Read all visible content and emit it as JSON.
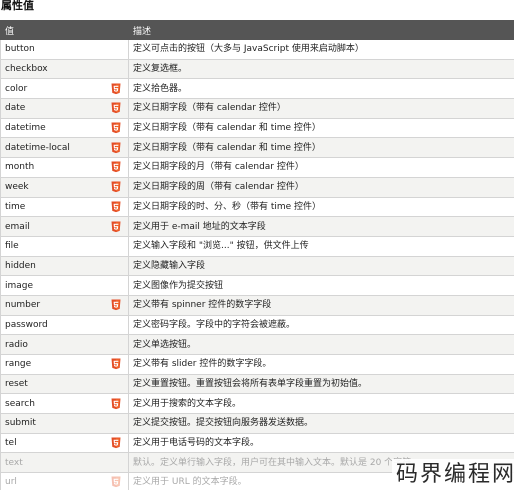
{
  "section_title": "属性值",
  "table": {
    "headers": {
      "value": "值",
      "description": "描述"
    },
    "rows": [
      {
        "value": "button",
        "description": "定义可点击的按钮（大多与 JavaScript 使用来启动脚本）",
        "html5": false
      },
      {
        "value": "checkbox",
        "description": "定义复选框。",
        "html5": false
      },
      {
        "value": "color",
        "description": "定义拾色器。",
        "html5": true
      },
      {
        "value": "date",
        "description": "定义日期字段（带有 calendar 控件）",
        "html5": true
      },
      {
        "value": "datetime",
        "description": "定义日期字段（带有 calendar 和 time 控件）",
        "html5": true
      },
      {
        "value": "datetime-local",
        "description": "定义日期字段（带有 calendar 和 time 控件）",
        "html5": true
      },
      {
        "value": "month",
        "description": "定义日期字段的月（带有 calendar 控件）",
        "html5": true
      },
      {
        "value": "week",
        "description": "定义日期字段的周（带有 calendar 控件）",
        "html5": true
      },
      {
        "value": "time",
        "description": "定义日期字段的时、分、秒（带有 time 控件）",
        "html5": true
      },
      {
        "value": "email",
        "description": "定义用于 e-mail 地址的文本字段",
        "html5": true
      },
      {
        "value": "file",
        "description": "定义输入字段和 \"浏览...\" 按钮，供文件上传",
        "html5": false
      },
      {
        "value": "hidden",
        "description": "定义隐藏输入字段",
        "html5": false
      },
      {
        "value": "image",
        "description": "定义图像作为提交按钮",
        "html5": false
      },
      {
        "value": "number",
        "description": "定义带有 spinner 控件的数字字段",
        "html5": true
      },
      {
        "value": "password",
        "description": "定义密码字段。字段中的字符会被遮蔽。",
        "html5": false
      },
      {
        "value": "radio",
        "description": "定义单选按钮。",
        "html5": false
      },
      {
        "value": "range",
        "description": "定义带有 slider 控件的数字字段。",
        "html5": true
      },
      {
        "value": "reset",
        "description": "定义重置按钮。重置按钮会将所有表单字段重置为初始值。",
        "html5": false
      },
      {
        "value": "search",
        "description": "定义用于搜索的文本字段。",
        "html5": true
      },
      {
        "value": "submit",
        "description": "定义提交按钮。提交按钮向服务器发送数据。",
        "html5": false
      },
      {
        "value": "tel",
        "description": "定义用于电话号码的文本字段。",
        "html5": true
      },
      {
        "value": "text",
        "description": "默认。定义单行输入字段，用户可在其中输入文本。默认是 20 个字符。",
        "html5": false,
        "faded": true
      },
      {
        "value": "url",
        "description": "定义用于 URL 的文本字段。",
        "html5": true,
        "faded": true
      }
    ]
  },
  "watermark": "码界编程网",
  "colors": {
    "header_bg": "#555555",
    "html5_badge": "#e44d26",
    "row_alt": "#f3f3f1"
  },
  "icons": {
    "html5_badge": "html5-shield-icon"
  }
}
